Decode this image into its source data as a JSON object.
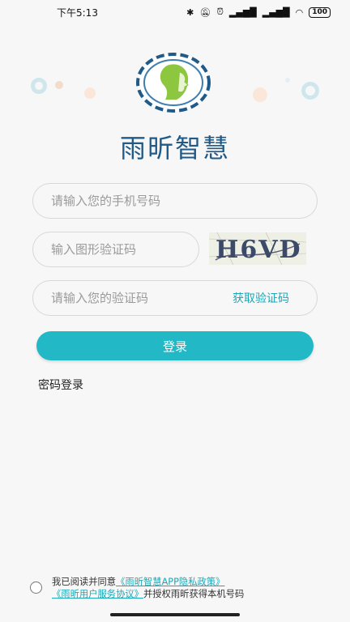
{
  "status_bar": {
    "time": "下午5:13",
    "battery": "100",
    "icons": [
      "bluetooth-icon",
      "mute-bell-icon",
      "alarm-icon",
      "hd-signal-icon",
      "hd-signal-icon",
      "wifi-icon",
      "battery-icon"
    ]
  },
  "brand": {
    "title": "雨昕智慧",
    "logo": "woman-profile-logo"
  },
  "form": {
    "phone_placeholder": "请输入您的手机号码",
    "captcha_placeholder": "输入图形验证码",
    "captcha_text": "H6VD",
    "code_placeholder": "请输入您的验证码",
    "get_code_label": "获取验证码",
    "login_label": "登录",
    "password_login_label": "密码登录"
  },
  "agreement": {
    "prefix": "我已阅读并同意",
    "privacy_link": "《雨昕智慧APP隐私政策》",
    "service_link": "《雨昕用户服务协议》",
    "suffix": "并授权雨昕获得本机号码"
  },
  "colors": {
    "accent": "#22b8c6",
    "brand_title": "#1f5a88",
    "link": "#1aa9b8"
  }
}
